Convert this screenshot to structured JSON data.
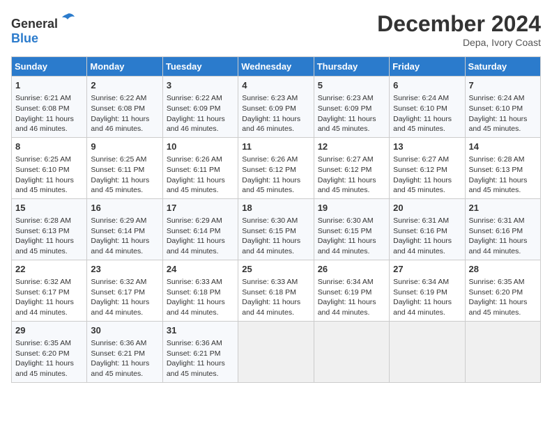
{
  "logo": {
    "general": "General",
    "blue": "Blue"
  },
  "header": {
    "title": "December 2024",
    "location": "Depa, Ivory Coast"
  },
  "weekdays": [
    "Sunday",
    "Monday",
    "Tuesday",
    "Wednesday",
    "Thursday",
    "Friday",
    "Saturday"
  ],
  "weeks": [
    [
      {
        "day": 1,
        "sunrise": "6:21 AM",
        "sunset": "6:08 PM",
        "daylight": "11 hours and 46 minutes."
      },
      {
        "day": 2,
        "sunrise": "6:22 AM",
        "sunset": "6:08 PM",
        "daylight": "11 hours and 46 minutes."
      },
      {
        "day": 3,
        "sunrise": "6:22 AM",
        "sunset": "6:09 PM",
        "daylight": "11 hours and 46 minutes."
      },
      {
        "day": 4,
        "sunrise": "6:23 AM",
        "sunset": "6:09 PM",
        "daylight": "11 hours and 46 minutes."
      },
      {
        "day": 5,
        "sunrise": "6:23 AM",
        "sunset": "6:09 PM",
        "daylight": "11 hours and 45 minutes."
      },
      {
        "day": 6,
        "sunrise": "6:24 AM",
        "sunset": "6:10 PM",
        "daylight": "11 hours and 45 minutes."
      },
      {
        "day": 7,
        "sunrise": "6:24 AM",
        "sunset": "6:10 PM",
        "daylight": "11 hours and 45 minutes."
      }
    ],
    [
      {
        "day": 8,
        "sunrise": "6:25 AM",
        "sunset": "6:10 PM",
        "daylight": "11 hours and 45 minutes."
      },
      {
        "day": 9,
        "sunrise": "6:25 AM",
        "sunset": "6:11 PM",
        "daylight": "11 hours and 45 minutes."
      },
      {
        "day": 10,
        "sunrise": "6:26 AM",
        "sunset": "6:11 PM",
        "daylight": "11 hours and 45 minutes."
      },
      {
        "day": 11,
        "sunrise": "6:26 AM",
        "sunset": "6:12 PM",
        "daylight": "11 hours and 45 minutes."
      },
      {
        "day": 12,
        "sunrise": "6:27 AM",
        "sunset": "6:12 PM",
        "daylight": "11 hours and 45 minutes."
      },
      {
        "day": 13,
        "sunrise": "6:27 AM",
        "sunset": "6:12 PM",
        "daylight": "11 hours and 45 minutes."
      },
      {
        "day": 14,
        "sunrise": "6:28 AM",
        "sunset": "6:13 PM",
        "daylight": "11 hours and 45 minutes."
      }
    ],
    [
      {
        "day": 15,
        "sunrise": "6:28 AM",
        "sunset": "6:13 PM",
        "daylight": "11 hours and 45 minutes."
      },
      {
        "day": 16,
        "sunrise": "6:29 AM",
        "sunset": "6:14 PM",
        "daylight": "11 hours and 44 minutes."
      },
      {
        "day": 17,
        "sunrise": "6:29 AM",
        "sunset": "6:14 PM",
        "daylight": "11 hours and 44 minutes."
      },
      {
        "day": 18,
        "sunrise": "6:30 AM",
        "sunset": "6:15 PM",
        "daylight": "11 hours and 44 minutes."
      },
      {
        "day": 19,
        "sunrise": "6:30 AM",
        "sunset": "6:15 PM",
        "daylight": "11 hours and 44 minutes."
      },
      {
        "day": 20,
        "sunrise": "6:31 AM",
        "sunset": "6:16 PM",
        "daylight": "11 hours and 44 minutes."
      },
      {
        "day": 21,
        "sunrise": "6:31 AM",
        "sunset": "6:16 PM",
        "daylight": "11 hours and 44 minutes."
      }
    ],
    [
      {
        "day": 22,
        "sunrise": "6:32 AM",
        "sunset": "6:17 PM",
        "daylight": "11 hours and 44 minutes."
      },
      {
        "day": 23,
        "sunrise": "6:32 AM",
        "sunset": "6:17 PM",
        "daylight": "11 hours and 44 minutes."
      },
      {
        "day": 24,
        "sunrise": "6:33 AM",
        "sunset": "6:18 PM",
        "daylight": "11 hours and 44 minutes."
      },
      {
        "day": 25,
        "sunrise": "6:33 AM",
        "sunset": "6:18 PM",
        "daylight": "11 hours and 44 minutes."
      },
      {
        "day": 26,
        "sunrise": "6:34 AM",
        "sunset": "6:19 PM",
        "daylight": "11 hours and 44 minutes."
      },
      {
        "day": 27,
        "sunrise": "6:34 AM",
        "sunset": "6:19 PM",
        "daylight": "11 hours and 44 minutes."
      },
      {
        "day": 28,
        "sunrise": "6:35 AM",
        "sunset": "6:20 PM",
        "daylight": "11 hours and 45 minutes."
      }
    ],
    [
      {
        "day": 29,
        "sunrise": "6:35 AM",
        "sunset": "6:20 PM",
        "daylight": "11 hours and 45 minutes."
      },
      {
        "day": 30,
        "sunrise": "6:36 AM",
        "sunset": "6:21 PM",
        "daylight": "11 hours and 45 minutes."
      },
      {
        "day": 31,
        "sunrise": "6:36 AM",
        "sunset": "6:21 PM",
        "daylight": "11 hours and 45 minutes."
      },
      null,
      null,
      null,
      null
    ]
  ]
}
